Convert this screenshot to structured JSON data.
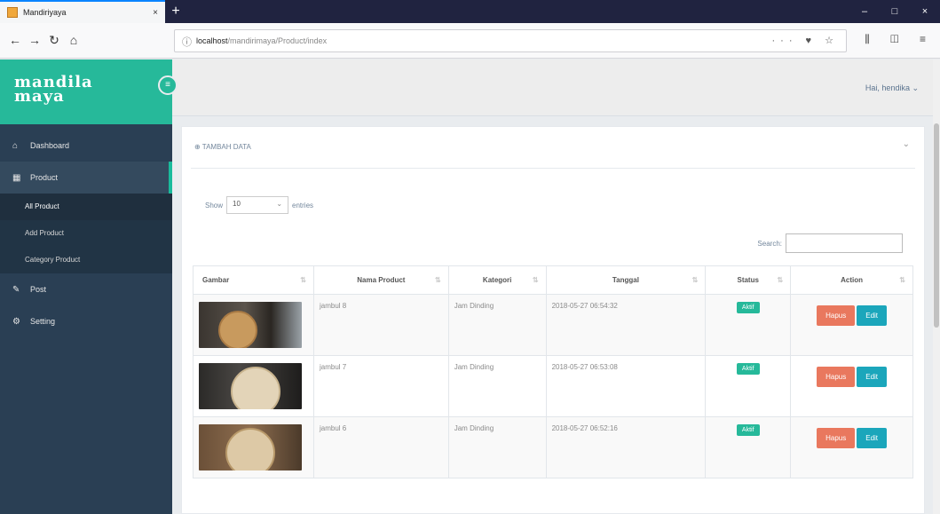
{
  "browser": {
    "tab_title": "Mandiriyaya",
    "tab_close": "×",
    "new_tab": "+",
    "url_host": "localhost",
    "url_path": "/mandirimaya/Product/index",
    "page_actions": "··· ♥ ☆",
    "toolbar_right": "⫼ ◫ ≡",
    "window_controls": [
      "–",
      "□",
      "×"
    ]
  },
  "sidebar": {
    "brand": [
      "mandila",
      "maya"
    ],
    "toggle_icon": "≡",
    "items": [
      {
        "icon": "⌂",
        "label": "Dashboard"
      },
      {
        "icon": "▦",
        "label": "Product"
      },
      {
        "icon": "✎",
        "label": "Post"
      },
      {
        "icon": "⚙",
        "label": "Setting"
      }
    ],
    "submenu": [
      "All Product",
      "Add Product",
      "Category Product"
    ]
  },
  "topnav": {
    "user": "Hai, hendika ⌄"
  },
  "panel": {
    "title": "TAMBAH DATA",
    "title_icon": "⊕",
    "collapse_icon": "⌄",
    "show_label": "Show",
    "length_value": "10",
    "entries_label": "entries",
    "search_label": "Search:"
  },
  "table": {
    "columns": [
      "Gambar",
      "Nama Product",
      "Kategori",
      "Tanggal",
      "Status",
      "Action"
    ],
    "rows": [
      {
        "name": "jambul 8",
        "category": "Jam Dinding",
        "date": "2018-05-27 06:54:32",
        "status": "Aktif"
      },
      {
        "name": "jambul 7",
        "category": "Jam Dinding",
        "date": "2018-05-27 06:53:08",
        "status": "Aktif"
      },
      {
        "name": "jambul 6",
        "category": "Jam Dinding",
        "date": "2018-05-27 06:52:16",
        "status": "Aktif"
      }
    ],
    "hapus_label": "Hapus",
    "edit_label": "Edit"
  },
  "colors": {
    "brand": "#26b99a",
    "sidebar": "#2a3f54",
    "hapus": "#e9785e",
    "edit": "#1ba6bb"
  }
}
